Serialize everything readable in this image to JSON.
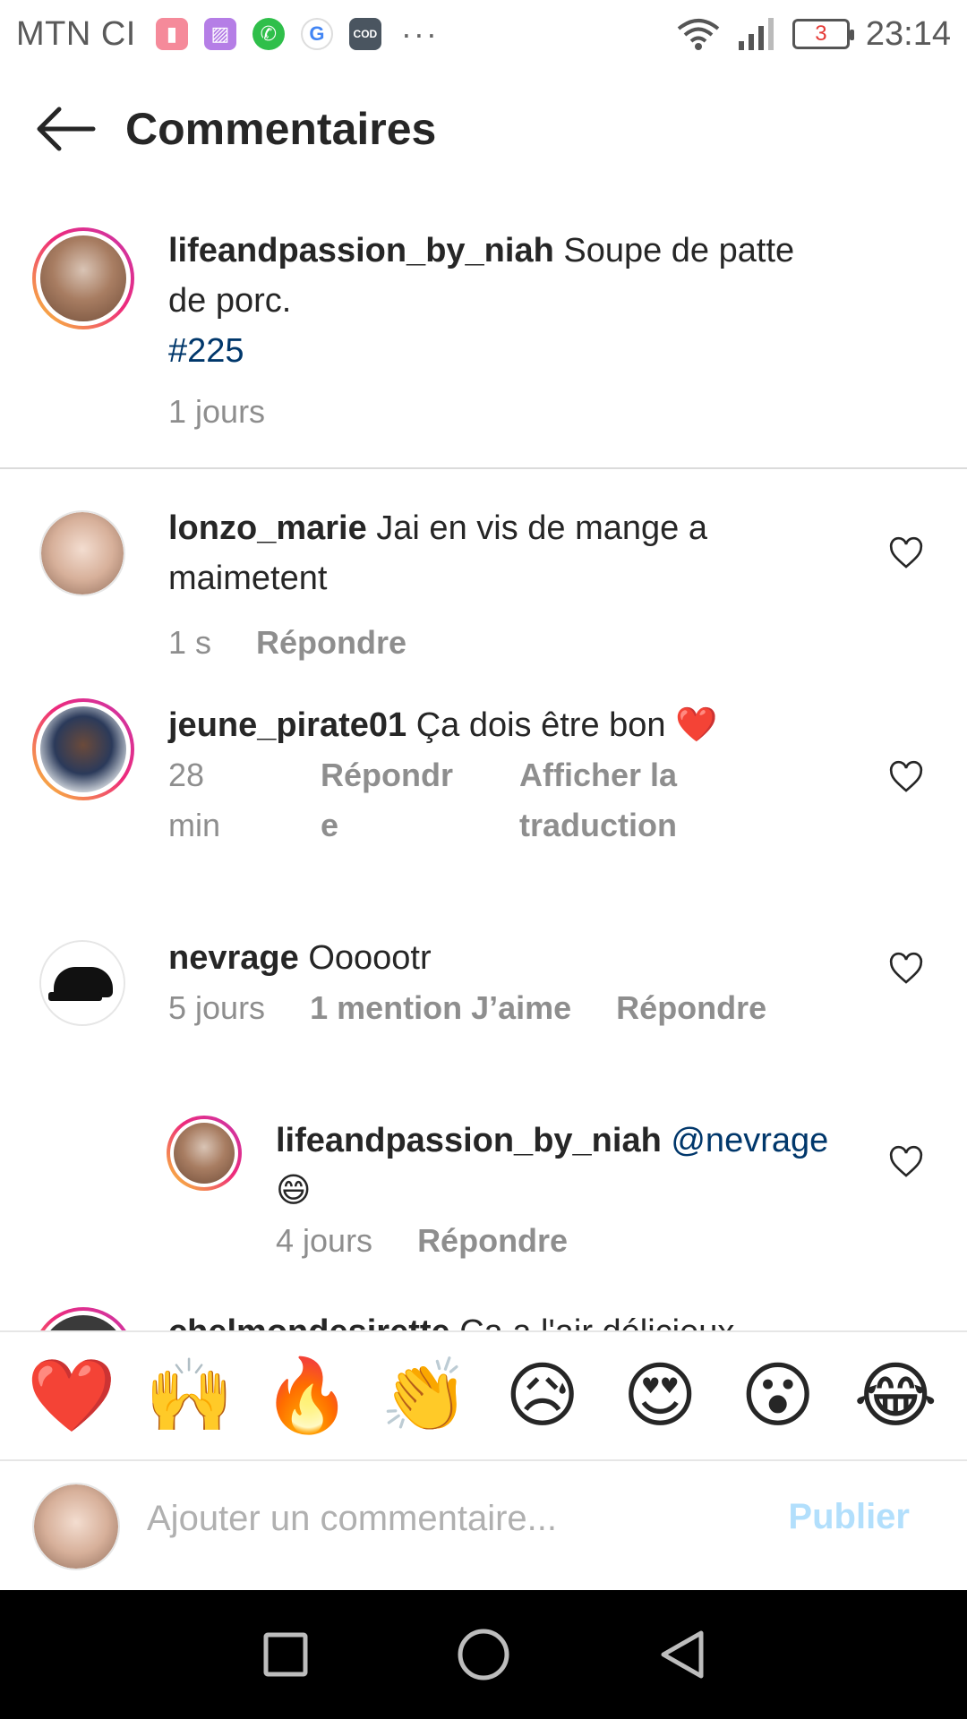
{
  "status_bar": {
    "carrier": "MTN CI",
    "battery": "3",
    "time": "23:14",
    "icons": [
      "battery-saver-icon",
      "gallery-icon",
      "whatsapp-icon",
      "google-icon",
      "call-of-duty-icon",
      "more-dots-icon",
      "wifi-icon",
      "signal-icon"
    ]
  },
  "header": {
    "title": "Commentaires",
    "back_icon": "arrow-left-icon"
  },
  "caption": {
    "username": "lifeandpassion_by_niah",
    "text_line1": "Soupe de patte",
    "text_line2": "de porc.",
    "hashtag": "#225",
    "time": "1 jours"
  },
  "comments": [
    {
      "username": "lonzo_marie",
      "text_inline": "Jai en vis de mange a",
      "text_cont": "maimetent",
      "time": "1 s",
      "reply": "Répondre"
    },
    {
      "username": "jeune_pirate01",
      "text": "Ça dois être bon",
      "emoji": "❤️",
      "time_line1": "28",
      "time_line2": "min",
      "reply_line1": "Répondr",
      "reply_line2": "e",
      "translate_line1": "Afficher la",
      "translate_line2": "traduction"
    },
    {
      "username": "nevrage",
      "text": "Oooootr",
      "time": "5 jours",
      "likes": "1 mention J’aime",
      "reply": "Répondre"
    }
  ],
  "reply": {
    "username": "lifeandpassion_by_niah",
    "mention": "@nevrage",
    "emoji": "😄",
    "time": "4 jours",
    "reply": "Répondre"
  },
  "partial_comment": {
    "username": "chelmondesirette",
    "text": "Ça a l'air délicieux"
  },
  "emoji_bar": [
    "❤️",
    "🙌",
    "🔥",
    "👏",
    "😥",
    "😍",
    "😮",
    "😂"
  ],
  "composer": {
    "placeholder": "Ajouter un commentaire...",
    "publish": "Publier"
  },
  "navbar": {
    "icons": [
      "recents-square-icon",
      "home-circle-icon",
      "back-triangle-icon"
    ]
  },
  "colors": {
    "link": "#00376b",
    "muted": "#8e8e8e",
    "publish_disabled": "#b2dffc",
    "heart_red": "#ed1f33"
  }
}
